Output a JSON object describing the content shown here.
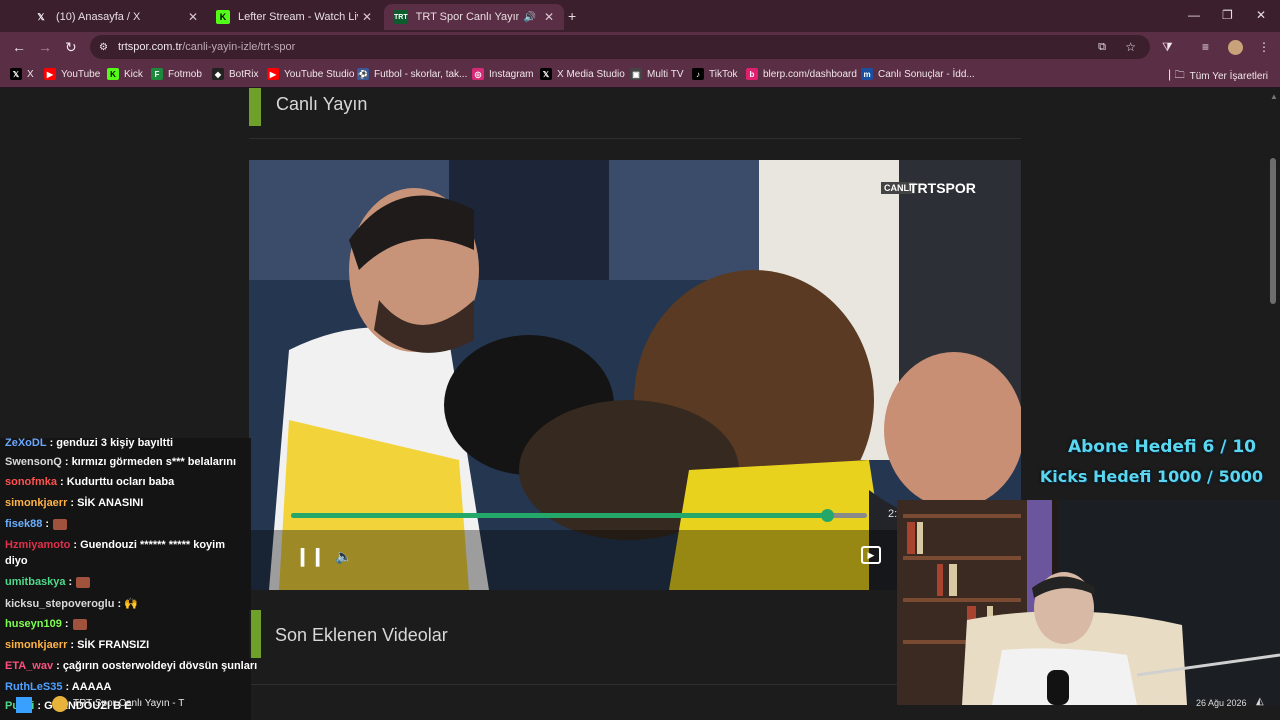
{
  "tabs": [
    {
      "title": "(10) Anasayfa / X",
      "icon": "x-logo-icon"
    },
    {
      "title": "Lefter Stream - Watch Live on K",
      "icon": "kick-logo-icon"
    },
    {
      "title": "TRT Spor Canlı Yayın - TRTS",
      "icon": "trt-logo-icon"
    }
  ],
  "address": {
    "domain": "trtspor.com.tr",
    "path": "/canli-yayin-izle/trt-spor"
  },
  "bookmarks": [
    {
      "label": "X",
      "icon": "x-logo-icon",
      "color": "#000000"
    },
    {
      "label": "YouTube",
      "icon": "youtube-icon",
      "color": "#ff0000"
    },
    {
      "label": "Kick",
      "icon": "kick-logo-icon",
      "color": "#53fc18"
    },
    {
      "label": "Fotmob",
      "icon": "fotmob-icon",
      "color": "#1c8a3c"
    },
    {
      "label": "BotRix",
      "icon": "botrix-icon",
      "color": "#222222"
    },
    {
      "label": "YouTube Studio",
      "icon": "youtube-studio-icon",
      "color": "#ff0000"
    },
    {
      "label": "Futbol - skorlar, tak...",
      "icon": "flashscore-icon",
      "color": "#3b5998"
    },
    {
      "label": "Instagram",
      "icon": "instagram-icon",
      "color": "#d62976"
    },
    {
      "label": "X Media Studio",
      "icon": "x-logo-icon",
      "color": "#000000"
    },
    {
      "label": "Multi TV",
      "icon": "multitv-icon",
      "color": "#444444"
    },
    {
      "label": "TikTok",
      "icon": "tiktok-icon",
      "color": "#000000"
    },
    {
      "label": "blerp.com/dashboard",
      "icon": "blerp-icon",
      "color": "#e0206f"
    },
    {
      "label": "Canlı Sonuçlar - İdd...",
      "icon": "mackolik-icon",
      "color": "#1a4fa0"
    }
  ],
  "all_bookmarks": "Tüm Yer İşaretleri",
  "live_title": "Canlı Yayın",
  "recent_title": "Son Eklenen Videolar",
  "player": {
    "logo_small": "CANLI",
    "logo_main": "TRTSPOR",
    "time": "2:",
    "progress": 0.93
  },
  "goals": {
    "subs": "Abone Hedefi 6 / 10",
    "kicks": "Kicks Hedefi 1000 / 5000"
  },
  "chat": [
    {
      "user": "ZeXoDL",
      "color": "#6aa8ff",
      "text": ": genduzi 3 kişiy bayıltti"
    },
    {
      "user": "SwensonQ",
      "color": "#d9d9d9",
      "text": ": kırmızı görmeden s*** belalarını"
    },
    {
      "user": "sonofmka",
      "color": "#ff5050",
      "text": ": Kudurttu ocları baba"
    },
    {
      "user": "simonkjaerr",
      "color": "#ffb347",
      "text": ": SİK ANASINI"
    },
    {
      "user": "fisek88",
      "color": "#6ab0ff",
      "text": ":",
      "emote": true
    },
    {
      "user": "Hzmiyamoto",
      "color": "#e0304a",
      "text": ": Guendouzi ****** ***** koyim"
    },
    {
      "user": "",
      "color": "#ffffff",
      "text": "diyo"
    },
    {
      "user": "umitbaskya",
      "color": "#4fd98b",
      "text": ":",
      "emote": true
    },
    {
      "user": "kicksu_stepoveroglu",
      "color": "#d9d9d9",
      "text": ": 🙌"
    },
    {
      "user": "huseyn109",
      "color": "#7dff4f",
      "text": ":",
      "emote": true
    },
    {
      "user": "simonkjaerr",
      "color": "#ffb347",
      "text": ": SİK FRANSIZI"
    },
    {
      "user": "ETA_wav",
      "color": "#ff4f7d",
      "text": ": çağırın oosterwoldeyi dövsün şunları"
    },
    {
      "user": "RuthLeS35",
      "color": "#4fa0ff",
      "text": ": AAAAA"
    },
    {
      "user": "Puxxi",
      "color": "#4fd98b",
      "text": ": GUENDOUZI B E"
    }
  ],
  "taskbar": {
    "app": "TRT Spor Canlı Yayın - T",
    "date": "26 Ağu 2026"
  }
}
